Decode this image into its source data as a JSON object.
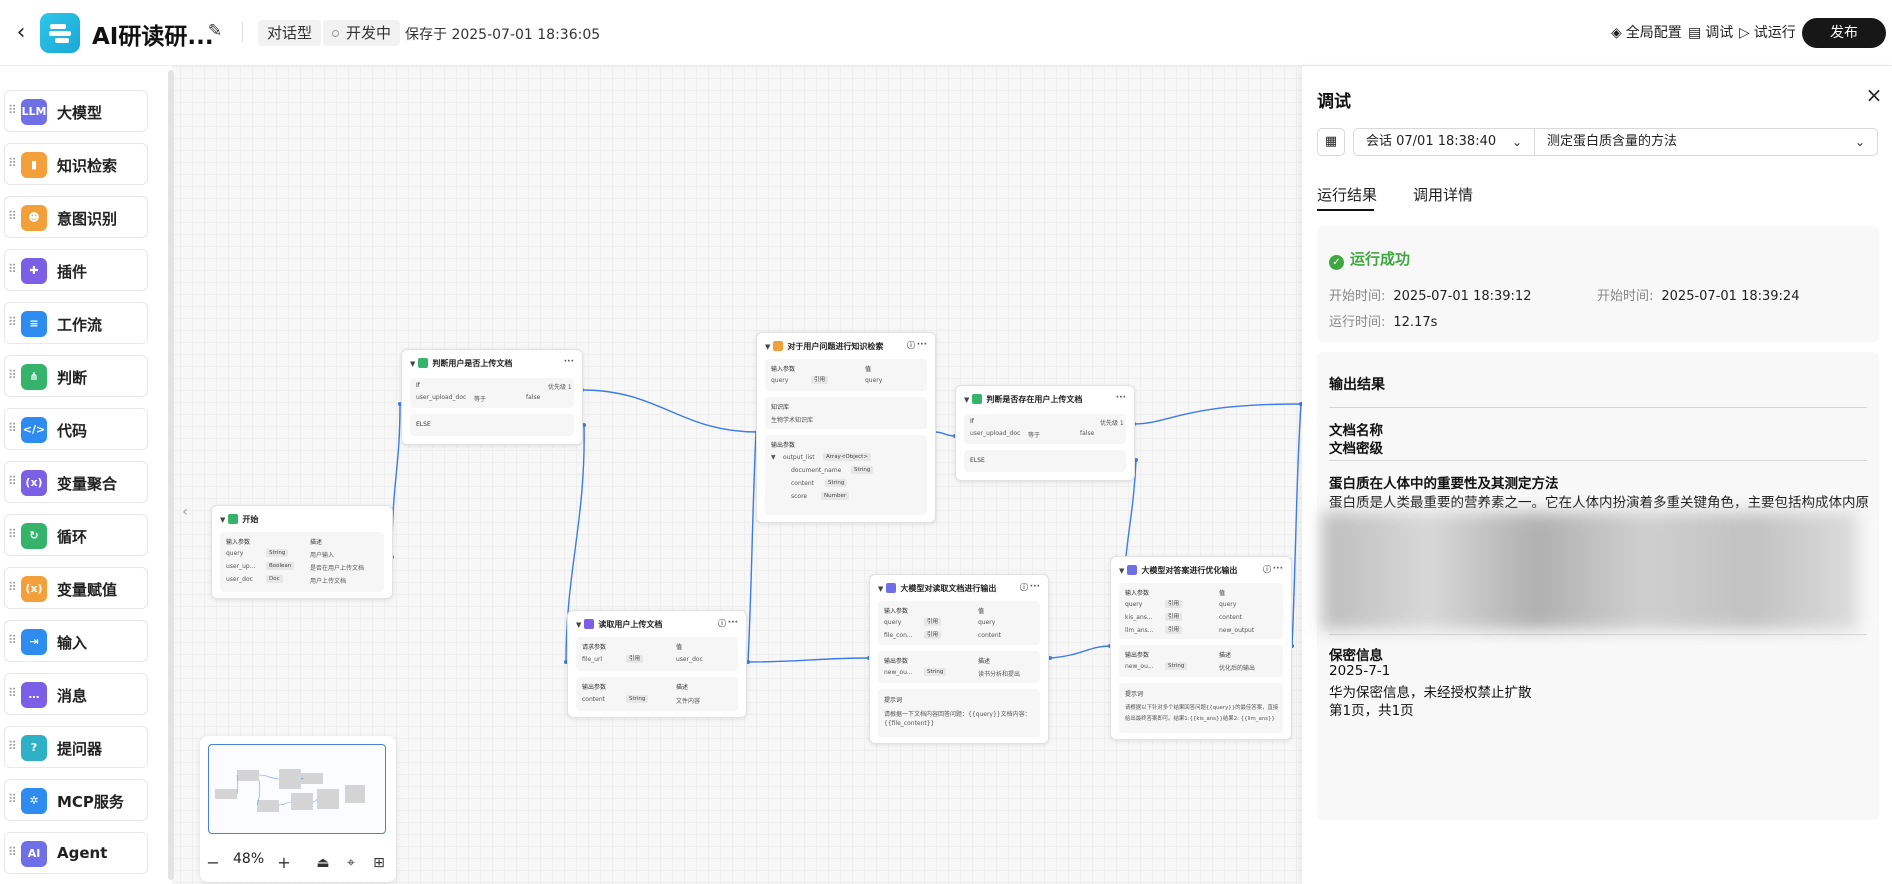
{
  "topbar": {
    "app_title": "AI研读研...",
    "tag_type": "对话型",
    "tag_status": "开发中",
    "saved_text": "保存于 2025-07-01 18:36:05",
    "global_config": "全局配置",
    "debug": "调试",
    "test_run": "试运行",
    "publish": "发布"
  },
  "palette": [
    {
      "label": "大模型",
      "icon": "LLM",
      "color": "#6f6fe8"
    },
    {
      "label": "知识检索",
      "icon": "book-icon",
      "color": "#f3a03b"
    },
    {
      "label": "意图识别",
      "icon": "intent-icon",
      "color": "#f3a03b"
    },
    {
      "label": "插件",
      "icon": "puzzle-icon",
      "color": "#7b5fe6"
    },
    {
      "label": "工作流",
      "icon": "workflow-icon",
      "color": "#2e8cf0"
    },
    {
      "label": "判断",
      "icon": "branch-icon",
      "color": "#36b36a"
    },
    {
      "label": "代码",
      "icon": "code-icon",
      "color": "#2e8cf0"
    },
    {
      "label": "变量聚合",
      "icon": "aggregate-icon",
      "color": "#7b5fe6"
    },
    {
      "label": "循环",
      "icon": "loop-icon",
      "color": "#36b36a"
    },
    {
      "label": "变量赋值",
      "icon": "assign-icon",
      "color": "#f3a03b"
    },
    {
      "label": "输入",
      "icon": "input-icon",
      "color": "#2e8cf0"
    },
    {
      "label": "消息",
      "icon": "message-icon",
      "color": "#7b5fe6"
    },
    {
      "label": "提问器",
      "icon": "question-icon",
      "color": "#2eb0c7"
    },
    {
      "label": "MCP服务",
      "icon": "mcp-icon",
      "color": "#2e8cf0"
    },
    {
      "label": "Agent",
      "icon": "agent-icon",
      "color": "#6f6fe8"
    }
  ],
  "nodes": {
    "start": {
      "title": "开始",
      "h_param": "输入参数",
      "h_desc": "描述",
      "rows": [
        {
          "name": "query",
          "type": "String",
          "desc": "用户输入"
        },
        {
          "name": "user_up...",
          "type": "Boolean",
          "desc": "是否在用户上传文档"
        },
        {
          "name": "user_doc",
          "type": "Doc",
          "desc": "用户上传文档"
        }
      ]
    },
    "judge1": {
      "title": "判断用户是否上传文档",
      "if": "If",
      "priority": "优先级 1",
      "var": "user_upload_doc",
      "op": "等于",
      "val": "false",
      "else": "ELSE"
    },
    "read": {
      "title": "读取用户上传文档",
      "h_req": "请求参数",
      "h_val": "值",
      "req_name": "file_url",
      "req_chip": "引用",
      "req_val": "user_doc",
      "h_out": "输出参数",
      "h_desc": "描述",
      "out_name": "content",
      "out_type": "String",
      "out_desc": "文件内容"
    },
    "retrieve": {
      "title": "对于用户问题进行知识检索",
      "h_in": "输入参数",
      "h_val": "值",
      "in_name": "query",
      "in_chip": "引用",
      "in_val": "query",
      "kb_label": "知识库",
      "kb_value": "生物学术知识库",
      "h_out": "输出参数",
      "out_list": "output_list",
      "out_list_type": "Array<Object>",
      "fields": [
        {
          "name": "document_name",
          "type": "String"
        },
        {
          "name": "content",
          "type": "String"
        },
        {
          "name": "score",
          "type": "Number"
        }
      ]
    },
    "judge2": {
      "title": "判断是否存在用户上传文档",
      "if": "If",
      "priority": "优先级 1",
      "var": "user_upload_doc",
      "op": "等于",
      "val": "false",
      "else": "ELSE"
    },
    "llm_read": {
      "title": "大模型对读取文档进行输出",
      "h_in": "输入参数",
      "h_val": "值",
      "rows": [
        {
          "name": "query",
          "chip": "引用",
          "val": "query"
        },
        {
          "name": "file_con...",
          "chip": "引用",
          "val": "content"
        }
      ],
      "h_out": "输出参数",
      "h_desc": "描述",
      "out_name": "new_ou...",
      "out_type": "String",
      "out_desc": "读书分析和提出",
      "prompt_label": "提示词",
      "prompt_line1": "请根据一下文档内容回答问题：{{query}}文档内容：",
      "prompt_line2": "{{file_content}}"
    },
    "llm_opt": {
      "title": "大模型对答案进行优化输出",
      "h_in": "输入参数",
      "h_val": "值",
      "rows": [
        {
          "name": "query",
          "chip": "引用",
          "val": "query"
        },
        {
          "name": "kis_ans...",
          "chip": "引用",
          "val": "content"
        },
        {
          "name": "llm_ans...",
          "chip": "引用",
          "val": "new_output"
        }
      ],
      "h_out": "输出参数",
      "h_desc": "描述",
      "out_name": "new_ou...",
      "out_type": "String",
      "out_desc": "优化后的输出",
      "prompt_label": "提示词",
      "prompt_line1": "请根据以下针对多个结果回答问题{{query}}的最佳答案，直接",
      "prompt_line2": "给出最终答案即可。结果1:{{kis_ans}}结果2: {{llm_ans}}"
    }
  },
  "zoom": {
    "value": "48%"
  },
  "debug_panel": {
    "title": "调试",
    "session": "会话 07/01 18:38:40",
    "question": "测定蛋白质含量的方法",
    "tabs": [
      "运行结果",
      "调用详情"
    ],
    "status": "运行成功",
    "start_label": "开始时间:",
    "start_value": "2025-07-01 18:39:12",
    "end_label": "开始时间:",
    "end_value": "2025-07-01 18:39:24",
    "run_label": "运行时间:",
    "run_value": "12.17s",
    "output_title": "输出结果",
    "doc_name_label": "文档名称",
    "doc_level_label": "文档密级",
    "article_title": "蛋白质在人体中的重要性及其测定方法",
    "article_text": "蛋白质是人类最重要的营养素之一。它在人体内扮演着多重关键角色，主要包括构成体内原生质和修",
    "secret_title": "保密信息",
    "secret_date": "2025-7-1",
    "secret_notice": "华为保密信息，未经授权禁止扩散",
    "page_info": "第1页，共1页"
  }
}
